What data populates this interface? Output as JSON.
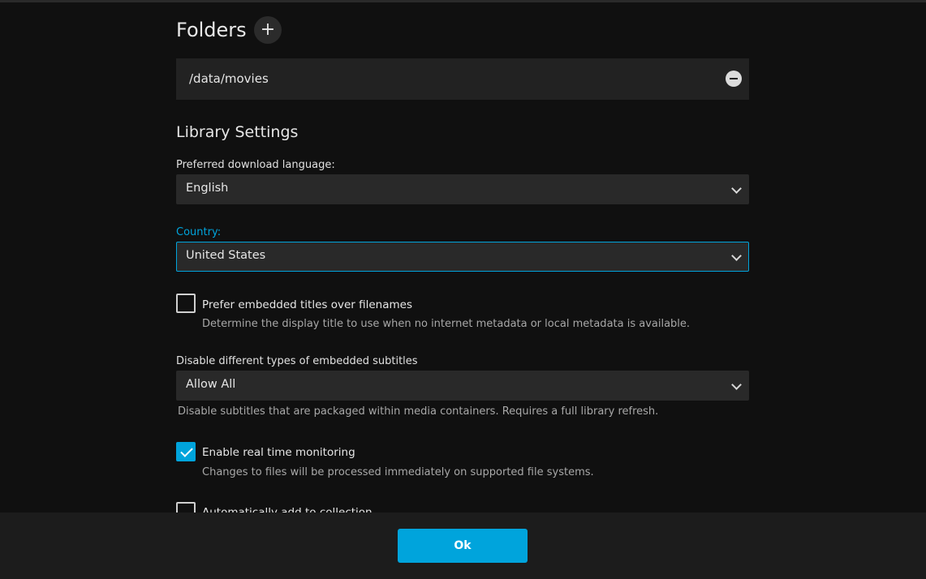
{
  "folders": {
    "title": "Folders",
    "add_label": "+",
    "items": [
      {
        "path": "/data/movies"
      }
    ]
  },
  "library_settings": {
    "title": "Library Settings",
    "download_language": {
      "label": "Preferred download language:",
      "value": "English"
    },
    "country": {
      "label": "Country:",
      "value": "United States"
    },
    "prefer_embedded_titles": {
      "label": "Prefer embedded titles over filenames",
      "help": "Determine the display title to use when no internet metadata or local metadata is available.",
      "checked": false
    },
    "embedded_subtitles": {
      "label": "Disable different types of embedded subtitles",
      "value": "Allow All",
      "help": "Disable subtitles that are packaged within media containers. Requires a full library refresh."
    },
    "real_time_monitoring": {
      "label": "Enable real time monitoring",
      "help": "Changes to files will be processed immediately on supported file systems.",
      "checked": true
    },
    "auto_add_collection": {
      "label": "Automatically add to collection",
      "checked": false
    }
  },
  "footer": {
    "ok_label": "Ok"
  },
  "colors": {
    "accent": "#00a4dc",
    "background": "#101010",
    "field_background": "#292929",
    "footer_background": "#1c1c1c"
  }
}
